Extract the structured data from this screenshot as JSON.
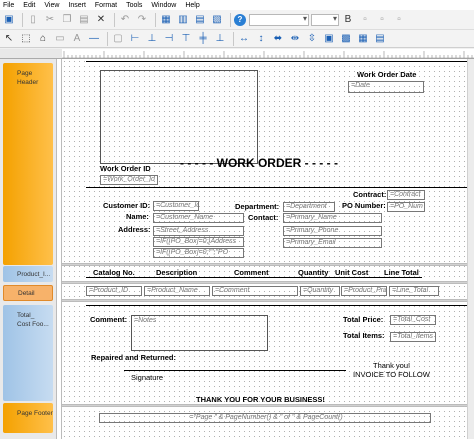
{
  "menu": [
    "File",
    "Edit",
    "View",
    "Insert",
    "Format",
    "Tools",
    "Window",
    "Help"
  ],
  "bands": {
    "page_header": "Page\nHeader",
    "product_header": "Product_I...",
    "detail": "Detail",
    "total_footer": "Total_\nCost Foo...",
    "page_footer": "Page Footer"
  },
  "report": {
    "work_order_date_label": "Work Order Date",
    "date_field": "=Date",
    "work_order_id_label": "Work Order ID",
    "work_order_id_field": "=Work_Order_Id",
    "title": "- - - - - WORK ORDER - - - - -",
    "contract_label": "Contract:",
    "contract_field": "=Contract",
    "po_label": "PO Number:",
    "po_field": "=PO_Num",
    "customer_id_label": "Customer ID:",
    "customer_id_field": "=Customer_Id",
    "name_label": "Name:",
    "name_field": "=Customer_Name",
    "address_label": "Address:",
    "address_field1": "=Street_Address",
    "address_field2": "=IF([PO_Box]=0;[Address",
    "address_field3": "=IF([PO_Box]=0;\"\";\"PO",
    "department_label": "Department:",
    "department_field": "=Department",
    "contact_label": "Contact:",
    "contact_field1": "=Primary_Name",
    "contact_field2": "=Primary_Phone",
    "contact_field3": "=Primary_Email",
    "columns": [
      "Catalog No.",
      "Description",
      "Comment",
      "Quantity",
      "Unit Cost",
      "Line Total"
    ],
    "detail_fields": [
      "=Product_ID",
      "=Product_Name",
      "=Comment",
      "=Quantity",
      "=Product_Price",
      "=Line_Total"
    ],
    "comment_label": "Comment:",
    "notes_field": "=Notes",
    "total_price_label": "Total Price:",
    "total_price_field": "=Total_Cost",
    "total_items_label": "Total Items:",
    "total_items_field": "=Total_Items",
    "repaired_label": "Repaired and Returned:",
    "signature_label": "Signature",
    "thanks_note_1": "Thank you!",
    "thanks_note_2": "INVOICE TO FOLLOW",
    "thanks_business": "THANK YOU FOR YOUR BUSINESS!",
    "page_footer_field": "=\"Page \" & PageNumber() & \" of \" & PageCount()"
  }
}
